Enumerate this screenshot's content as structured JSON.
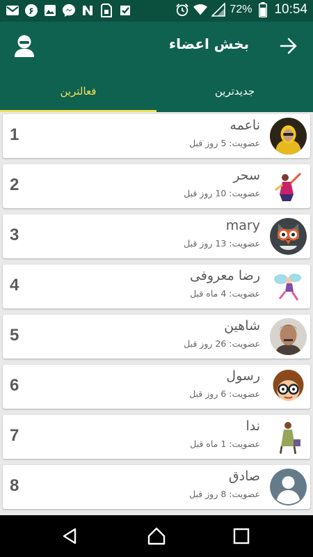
{
  "status_bar": {
    "battery": "72%",
    "time": "10:54",
    "left_icons": [
      "gmail-icon",
      "app-6-icon",
      "gallery-icon",
      "messenger-icon",
      "news-icon",
      "sim-icon",
      "check-icon"
    ],
    "right_icons": [
      "alarm-icon",
      "wifi-icon",
      "signal-icon",
      "battery-icon"
    ]
  },
  "app_bar": {
    "title": "بخش اعضاء"
  },
  "tabs": [
    {
      "label": "فعالترین",
      "active": true
    },
    {
      "label": "جدیدترین",
      "active": false
    }
  ],
  "members": [
    {
      "rank": "1",
      "name": "ناعمه",
      "joined": "عضویت: 5 روز قبل",
      "avatar": "woman-photo"
    },
    {
      "rank": "2",
      "name": "سحر",
      "joined": "عضویت: 10 روز قبل",
      "avatar": "dancer-cartoon"
    },
    {
      "rank": "3",
      "name": "mary",
      "joined": "عضویت: 13 روز قبل",
      "avatar": "owl-cartoon"
    },
    {
      "rank": "4",
      "name": "رضا معروفی",
      "joined": "عضویت: 4 ماه قبل",
      "avatar": "fairy-cartoon"
    },
    {
      "rank": "5",
      "name": "شاهین",
      "joined": "عضویت: 26 روز قبل",
      "avatar": "man-photo"
    },
    {
      "rank": "6",
      "name": "رسول",
      "joined": "عضویت: 6 روز قبل",
      "avatar": "glasses-cartoon"
    },
    {
      "rank": "7",
      "name": "ندا",
      "joined": "عضویت: 1 ماه قبل",
      "avatar": "shopper-cartoon"
    },
    {
      "rank": "8",
      "name": "صادق",
      "joined": "عضویت: 8 روز قبل",
      "avatar": "default-user"
    }
  ],
  "colors": {
    "status_bar": "#0b4f3f",
    "primary": "#0f6150",
    "tab_active": "#f1e05a",
    "list_bg": "#e9e9e9"
  }
}
